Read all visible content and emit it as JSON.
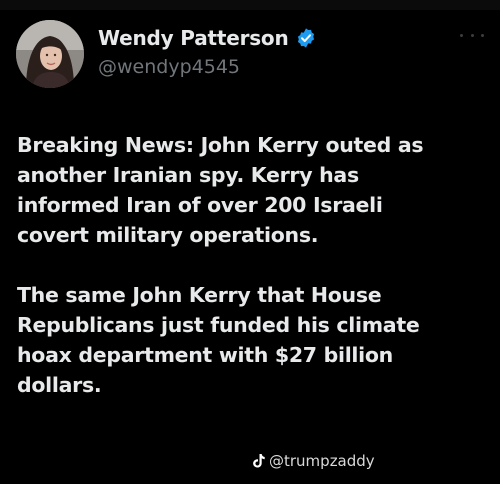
{
  "post": {
    "author": {
      "display_name": "Wendy Patterson",
      "handle": "@wendyp4545",
      "verified": true,
      "verified_icon": "verified-badge-icon",
      "avatar": "profile-photo"
    },
    "more_icon": "more-options-icon",
    "text": {
      "paragraph_1": "Breaking News: John Kerry outed as\nanother Iranian spy.  Kerry has\ninformed Iran of over 200 Israeli\ncovert military operations.",
      "paragraph_2": "The same John Kerry that House\nRepublicans just funded his climate\nhoax department with $27 billion\ndollars."
    }
  },
  "watermark": {
    "icon": "tiktok-icon",
    "text": "@trumpzaddy"
  },
  "colors": {
    "background": "#000000",
    "text_primary": "#e7e9ea",
    "text_secondary": "#71767b",
    "verified_blue": "#1d9bf0"
  }
}
